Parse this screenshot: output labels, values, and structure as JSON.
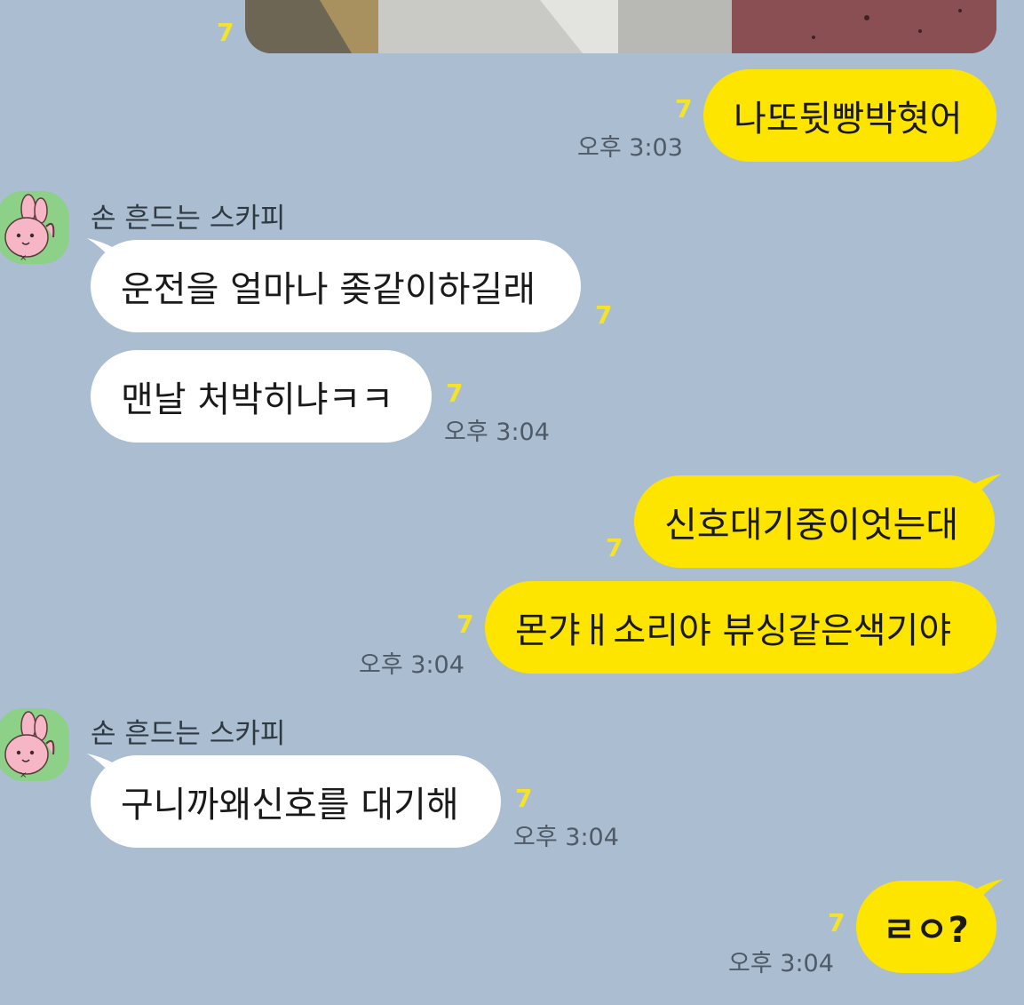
{
  "unread_mark": "7",
  "sender_name": "손 흔드는 스카피",
  "messages": {
    "m1": "나또뒷빵박혓어",
    "m2": "운전을 얼마나 좆같이하길래",
    "m3": "맨날 처박히냐ㅋㅋ",
    "m4": "신호대기중이엇는대",
    "m5": "몬갸ㅐ소리야 뷰싱같은색기야",
    "m6": "구니까왜신호를 대기해",
    "m7": "ㄹㅇ?"
  },
  "times": {
    "t1": "오후 3:03",
    "t2": "오후 3:04",
    "t3": "오후 3:04",
    "t4": "오후 3:04",
    "t5": "오후 3:04"
  },
  "colors": {
    "background": "#abbdd0",
    "my_bubble": "#fee500",
    "other_bubble": "#ffffff",
    "unread": "#f5e22a",
    "avatar_bg": "#8dd088"
  },
  "icons": {
    "avatar": "pink-rabbit-avatar-icon"
  }
}
